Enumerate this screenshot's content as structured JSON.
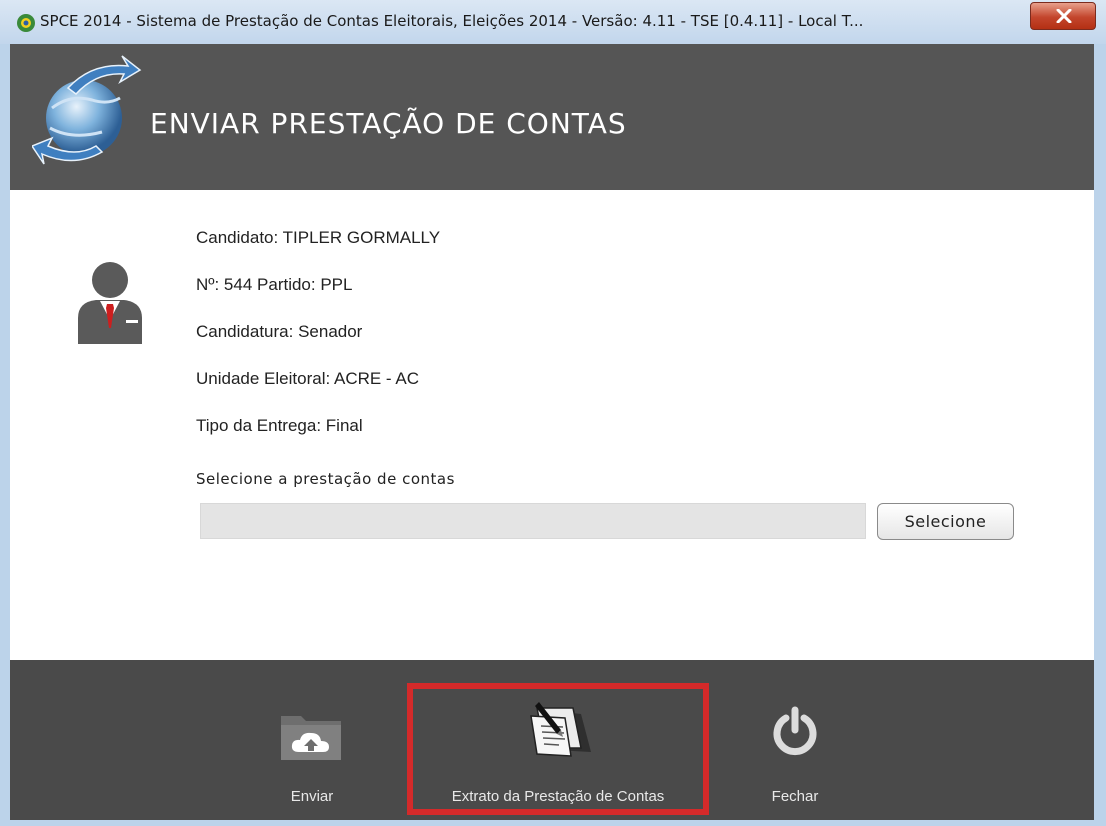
{
  "window": {
    "title": "SPCE 2014 - Sistema de Prestação de Contas Eleitorais, Eleições 2014 - Versão: 4.11  -  TSE [0.4.11] - Local T..."
  },
  "header": {
    "title": "ENVIAR PRESTAÇÃO DE CONTAS"
  },
  "candidate": {
    "nome": "Candidato: TIPLER GORMALLY",
    "numero_partido": "Nº: 544 Partido: PPL",
    "candidatura": "Candidatura: Senador",
    "unidade": "Unidade Eleitoral: ACRE - AC",
    "tipo_entrega": "Tipo da Entrega: Final"
  },
  "file_select": {
    "label": "Selecione a prestação de contas",
    "value": "",
    "button_label": "Selecione"
  },
  "footer": {
    "enviar_label": "Enviar",
    "extrato_label": "Extrato da Prestação de Contas",
    "fechar_label": "Fechar"
  },
  "colors": {
    "header_bg": "#555555",
    "footer_bg": "#4a4a4a",
    "highlight": "#d42a2a",
    "tie": "#cc1f1f"
  },
  "icons": {
    "app": "spce-logo-icon",
    "header": "globe-arrows-icon",
    "candidate": "person-icon",
    "enviar": "cloud-upload-folder-icon",
    "extrato": "documents-pen-icon",
    "fechar": "power-icon"
  }
}
